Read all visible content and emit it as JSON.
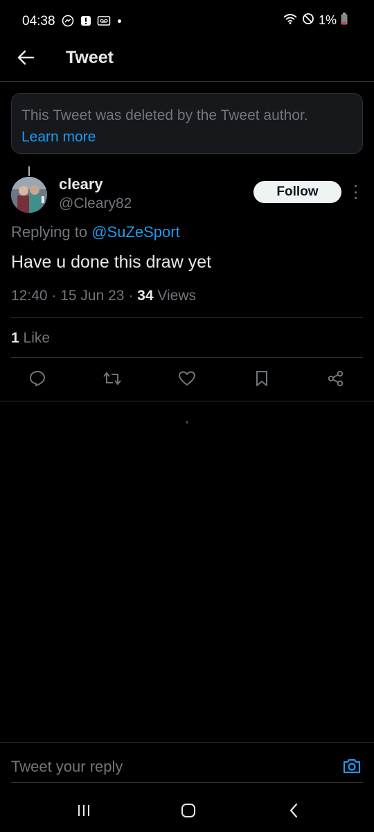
{
  "status_bar": {
    "time": "04:38",
    "battery": "1%",
    "icons_left": [
      "messenger-icon",
      "alert-icon",
      "voicemail-icon"
    ],
    "icons_right": [
      "wifi-icon",
      "do-not-disturb-icon",
      "battery-icon"
    ]
  },
  "header": {
    "title": "Tweet"
  },
  "deleted_notice": {
    "text": "This Tweet was deleted by the Tweet author.",
    "link": "Learn more"
  },
  "tweet": {
    "display_name": "cleary",
    "handle": "@Cleary82",
    "follow_label": "Follow",
    "replying_prefix": "Replying to",
    "replying_handle": "@SuZeSport",
    "text": "Have u done this draw yet",
    "time": "12:40",
    "date": "15 Jun 23",
    "views_count": "34",
    "views_label": "Views",
    "likes_count": "1",
    "likes_label": "Like"
  },
  "reply": {
    "placeholder": "Tweet your reply"
  },
  "colors": {
    "accent": "#1d9bf0",
    "background": "#000000",
    "muted": "#71767b",
    "divider": "#2f3336"
  }
}
